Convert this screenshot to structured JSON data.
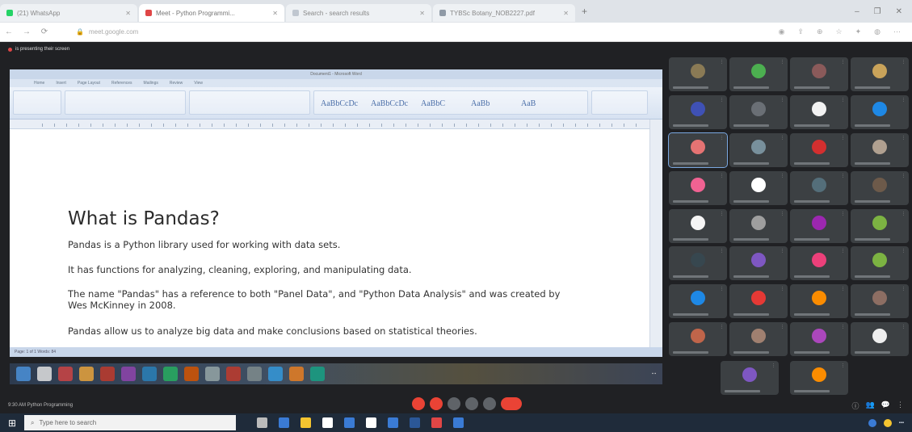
{
  "browser": {
    "tabs": [
      {
        "label": "(21) WhatsApp",
        "favicon_color": "#25d366",
        "active": false
      },
      {
        "label": "Meet - Python Programmi...",
        "favicon_color": "#e04646",
        "active": true
      },
      {
        "label": "Search - search results",
        "favicon_color": "#c0c7d0",
        "active": false
      },
      {
        "label": "TYBSc Botany_NOB2227.pdf",
        "favicon_color": "#8f9aa6",
        "active": false
      }
    ],
    "new_tab": "+",
    "window_controls": [
      "–",
      "❐",
      "✕"
    ],
    "url": "meet.google.com"
  },
  "meet": {
    "presenting_banner": "is presenting their screen",
    "meeting_info": "9:30 AM  Python Programming",
    "control_colors": [
      "#ea4335",
      "#ea4335",
      "#5f6368",
      "#5f6368",
      "#5f6368",
      "#ea4335"
    ],
    "right_controls": [
      "ⓘ",
      "👥",
      "💬",
      "⋮"
    ],
    "participants": [
      {
        "avatar": "#8a7a55"
      },
      {
        "avatar": "#4caf50"
      },
      {
        "avatar": "#8a5a5a"
      },
      {
        "avatar": "#c9a35a"
      },
      {
        "avatar": "#3f51b5"
      },
      {
        "avatar": "#6a6f75"
      },
      {
        "avatar": "#f2f2f2"
      },
      {
        "avatar": "#1e88e5"
      },
      {
        "avatar": "#e57373"
      },
      {
        "avatar": "#78909c"
      },
      {
        "avatar": "#d32f2f"
      },
      {
        "avatar": "#b0a090"
      },
      {
        "avatar": "#f06292"
      },
      {
        "avatar": "#ffffff"
      },
      {
        "avatar": "#546e7a"
      },
      {
        "avatar": "#6d5a4a"
      },
      {
        "avatar": "#f5f5f5"
      },
      {
        "avatar": "#9e9e9e"
      },
      {
        "avatar": "#9c27b0"
      },
      {
        "avatar": "#7cb342"
      },
      {
        "avatar": "#37474f"
      },
      {
        "avatar": "#7e57c2"
      },
      {
        "avatar": "#ec407a"
      },
      {
        "avatar": "#7cb342"
      },
      {
        "avatar": "#1e88e5"
      },
      {
        "avatar": "#e53935"
      },
      {
        "avatar": "#fb8c00"
      },
      {
        "avatar": "#8d6e63"
      },
      {
        "avatar": "#c0654a"
      },
      {
        "avatar": "#a08070"
      },
      {
        "avatar": "#ab47bc"
      },
      {
        "avatar": "#eeeeee"
      },
      {
        "avatar": "#7e57c2"
      },
      {
        "avatar": "#fb8c00"
      }
    ]
  },
  "document": {
    "app_title": "Document1 - Microsoft Word",
    "ribbon_tabs": [
      "Home",
      "Insert",
      "Page Layout",
      "References",
      "Mailings",
      "Review",
      "View"
    ],
    "styles": [
      "AaBbCcDc",
      "AaBbCcDc",
      "AaBbC",
      "AaBb",
      "AaB"
    ],
    "heading": "What is Pandas?",
    "paragraphs": [
      "Pandas is a Python library used for working with data sets.",
      "It has functions for analyzing, cleaning, exploring, and manipulating data.",
      "The name \"Pandas\" has a reference to both \"Panel Data\", and \"Python Data Analysis\" and was created by Wes McKinney in 2008.",
      "Pandas allow us to analyze big data and make conclusions based on statistical theories."
    ],
    "status": "Page: 1 of 1   Words: 84"
  },
  "taskbar": {
    "start_glyph": "⊞",
    "search_placeholder": "Type here to search",
    "search_glyph": "⌕",
    "app_colors": [
      "#bbbbbb",
      "#3a7bd5",
      "#f4c430",
      "#ffffff",
      "#3a7bd5",
      "#ffffff",
      "#3a7bd5",
      "#2b5797",
      "#e04646",
      "#3a7bd5"
    ],
    "tray_colors": [
      "#3a7bd5",
      "#f4c430"
    ]
  }
}
